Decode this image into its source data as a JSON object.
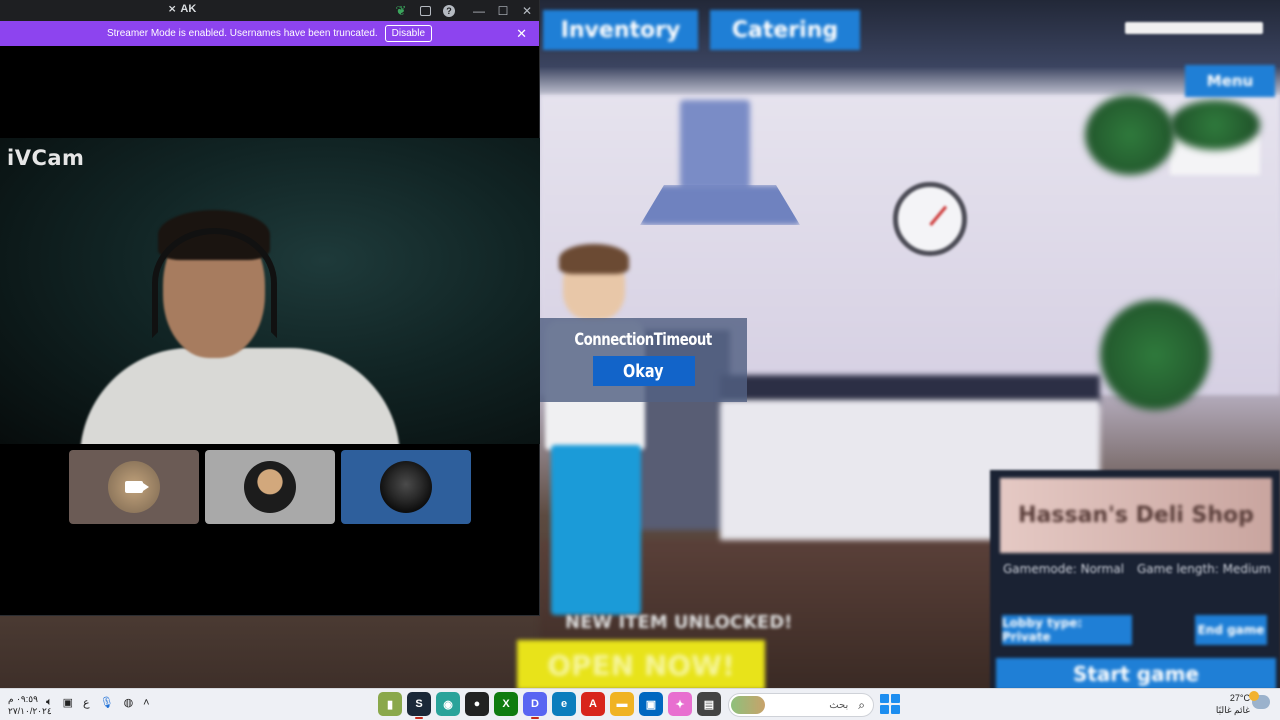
{
  "discord": {
    "window_title": "AK",
    "banner_text": "Streamer Mode is enabled. Usernames have been truncated.",
    "banner_button": "Disable",
    "banner_close": "✕",
    "stream_watermark": "iVCam",
    "win_minimize": "—",
    "win_maximize": "☐",
    "win_close": "✕",
    "help_glyph": "?"
  },
  "game": {
    "nav_tabs": [
      "Inventory",
      "Catering"
    ],
    "menu_button": "Menu",
    "lobby_banner": "Hassan's Deli Shop",
    "lobby_meta_left": "Gamemode: Normal",
    "lobby_meta_right": "Game length: Medium",
    "lobby_type": "Lobby type: Private",
    "end_game": "End game",
    "start_game": "Start game",
    "new_item": "NEW ITEM UNLOCKED!",
    "open_now": "OPEN NOW!"
  },
  "dialog": {
    "message": "ConnectionTimeout",
    "button": "Okay"
  },
  "taskbar": {
    "time": "٠٩:٥٩ م",
    "date": "٢٧/١٠/٢٠٢٤",
    "lang": "ع",
    "search_placeholder": "بحث",
    "temperature": "27°C",
    "weather_text": "غائم غالبًا",
    "apps": [
      {
        "name": "minecraft",
        "glyph": "▮",
        "color": "#8aa84b"
      },
      {
        "name": "steam",
        "glyph": "S",
        "color": "#1b2838"
      },
      {
        "name": "game-app",
        "glyph": "◉",
        "color": "#2aa39a"
      },
      {
        "name": "obs",
        "glyph": "●",
        "color": "#222"
      },
      {
        "name": "xbox",
        "glyph": "X",
        "color": "#107c10"
      },
      {
        "name": "discord",
        "glyph": "D",
        "color": "#5865f2"
      },
      {
        "name": "edge",
        "glyph": "e",
        "color": "#0c7dbd"
      },
      {
        "name": "acrobat",
        "glyph": "A",
        "color": "#d8251c"
      },
      {
        "name": "file-explorer",
        "glyph": "▬",
        "color": "#f0b323"
      },
      {
        "name": "store",
        "glyph": "▣",
        "color": "#0067c0"
      },
      {
        "name": "copilot",
        "glyph": "✦",
        "color": "#e86fd0"
      },
      {
        "name": "notepad",
        "glyph": "▤",
        "color": "#444"
      }
    ]
  },
  "colors": {
    "streamer_banner": "#8d44ef",
    "dialog_button": "#1264c9",
    "discord_titlebar": "#1e1f22"
  }
}
